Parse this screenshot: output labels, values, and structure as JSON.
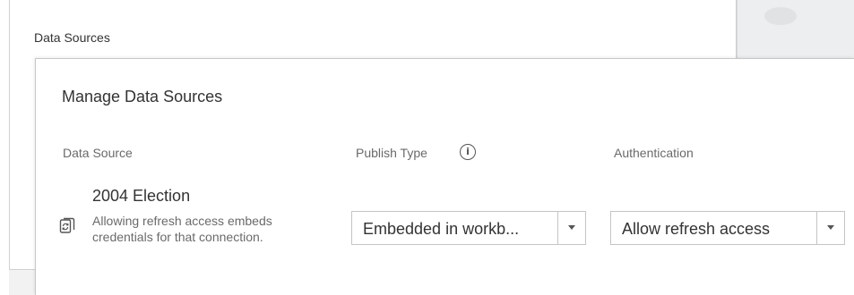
{
  "background_panel": {
    "title": "Data Sources"
  },
  "dialog": {
    "title": "Manage Data Sources",
    "columns": {
      "data_source": "Data Source",
      "publish_type": "Publish Type",
      "authentication": "Authentication"
    },
    "row": {
      "name": "2004 Election",
      "note": "Allowing refresh access embeds credentials for that connection.",
      "publish_type_value": "Embedded in workb...",
      "authentication_value": "Allow refresh access"
    },
    "icons": {
      "info": "info-icon",
      "data_source": "data-source-refresh-icon",
      "dropdown": "chevron-down-icon"
    }
  },
  "colors": {
    "text": "#333333",
    "muted": "#6a6a6a",
    "border": "#c4c4c4"
  }
}
